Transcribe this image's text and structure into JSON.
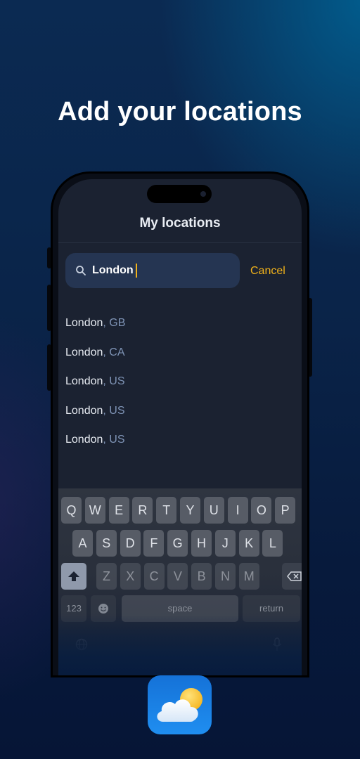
{
  "headline": "Add your locations",
  "screen": {
    "title": "My locations",
    "search": {
      "value": "London",
      "icon": "search-icon"
    },
    "cancel_label": "Cancel",
    "results": [
      {
        "city": "London",
        "country": "GB"
      },
      {
        "city": "London",
        "country": "CA"
      },
      {
        "city": "London",
        "country": "US"
      },
      {
        "city": "London",
        "country": "US"
      },
      {
        "city": "London",
        "country": "US"
      }
    ]
  },
  "keyboard": {
    "row1": [
      "Q",
      "W",
      "E",
      "R",
      "T",
      "Y",
      "U",
      "I",
      "O",
      "P"
    ],
    "row2": [
      "A",
      "S",
      "D",
      "F",
      "G",
      "H",
      "J",
      "K",
      "L"
    ],
    "row3": [
      "Z",
      "X",
      "C",
      "V",
      "B",
      "N",
      "M"
    ],
    "numbers_label": "123",
    "space_label": "space",
    "return_label": "return"
  },
  "colors": {
    "accent": "#f1b21a",
    "country_text": "#7f94b6",
    "search_bg": "#253552"
  }
}
